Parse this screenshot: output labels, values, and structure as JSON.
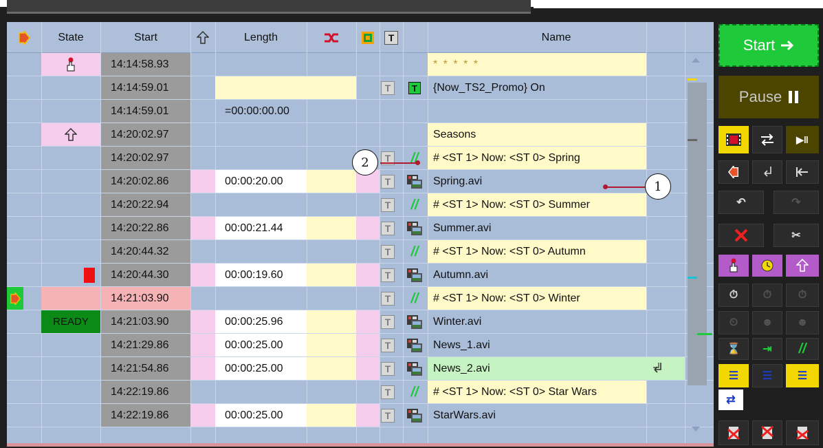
{
  "header": {
    "state": "State",
    "start": "Start",
    "length": "Length",
    "name": "Name",
    "t_label": "T"
  },
  "rows": [
    {
      "start": "14:14:58.93",
      "length": "",
      "name": "* * * * *",
      "state": "hand"
    },
    {
      "start": "14:14:59.01",
      "length": "",
      "name": "{Now_TS2_Promo} On",
      "state": ""
    },
    {
      "start": "14:14:59.01",
      "length": "=00:00:00.00",
      "name": "",
      "state": ""
    },
    {
      "start": "14:20:02.97",
      "length": "",
      "name": "Seasons",
      "state": "up"
    },
    {
      "start": "14:20:02.97",
      "length": "",
      "name": "# <ST 1> Now: <ST 0> Spring",
      "state": ""
    },
    {
      "start": "14:20:02.86",
      "length": "00:00:20.00",
      "name": "Spring.avi",
      "state": ""
    },
    {
      "start": "14:20:22.94",
      "length": "",
      "name": "# <ST 1> Now: <ST 0> Summer",
      "state": ""
    },
    {
      "start": "14:20:22.86",
      "length": "00:00:21.44",
      "name": "Summer.avi",
      "state": ""
    },
    {
      "start": "14:20:44.32",
      "length": "",
      "name": "# <ST 1> Now: <ST 0> Autumn",
      "state": ""
    },
    {
      "start": "14:20:44.30",
      "length": "00:00:19.60",
      "name": "Autumn.avi",
      "state": "red"
    },
    {
      "start": "14:21:03.90",
      "length": "",
      "name": "# <ST 1> Now: <ST 0> Winter",
      "state": ""
    },
    {
      "start": "14:21:03.90",
      "length": "00:00:25.96",
      "name": "Winter.avi",
      "state": "READY"
    },
    {
      "start": "14:21:29.86",
      "length": "00:00:25.00",
      "name": "News_1.avi",
      "state": ""
    },
    {
      "start": "14:21:54.86",
      "length": "00:00:25.00",
      "name": "News_2.avi",
      "state": ""
    },
    {
      "start": "14:22:19.86",
      "length": "",
      "name": "# <ST 1> Now: <ST 0> Star Wars",
      "state": ""
    },
    {
      "start": "14:22:19.86",
      "length": "00:00:25.00",
      "name": "StarWars.avi",
      "state": ""
    }
  ],
  "t_btn": "T",
  "ready": "READY",
  "panel": {
    "start": "Start",
    "pause": "Pause"
  },
  "callouts": {
    "one": "1",
    "two": "2"
  },
  "colors": {
    "grid_bg": "#a9bcd8",
    "start_col": "#9b9b9b",
    "yellow": "#fffac8",
    "pink": "#f7cdee",
    "ready_green": "#0c8a17",
    "start_btn": "#1ec93a",
    "pause_btn": "#4b4500"
  }
}
